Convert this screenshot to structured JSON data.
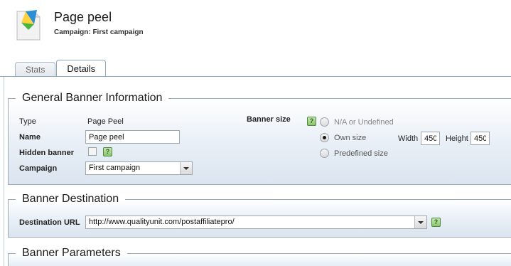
{
  "header": {
    "title": "Page peel",
    "subtitle": "Campaign: First campaign"
  },
  "tabs": [
    {
      "label": "Stats",
      "active": false
    },
    {
      "label": "Details",
      "active": true
    }
  ],
  "general": {
    "legend": "General Banner Information",
    "type_label": "Type",
    "type_value": "Page Peel",
    "name_label": "Name",
    "name_value": "Page peel",
    "hidden_label": "Hidden banner",
    "hidden_checked": false,
    "campaign_label": "Campaign",
    "campaign_value": "First campaign",
    "banner_size_label": "Banner size",
    "size_options": [
      {
        "label": "N/A or Undefined",
        "selected": false,
        "enabled": false
      },
      {
        "label": "Own size",
        "selected": true,
        "enabled": true
      },
      {
        "label": "Predefined size",
        "selected": false,
        "enabled": true
      }
    ],
    "width_label": "Width",
    "width_value": "450",
    "height_label": "Height",
    "height_value": "450"
  },
  "destination": {
    "legend": "Banner Destination",
    "url_label": "Destination URL",
    "url_value": "http://www.qualityunit.com/postaffiliatepro/"
  },
  "parameters": {
    "legend": "Banner Parameters"
  },
  "help_icon_text": "?",
  "colors": {
    "tab_border": "#8fa6bd",
    "section_bg": "#dbe5ef",
    "help_green": "#88c56a"
  }
}
